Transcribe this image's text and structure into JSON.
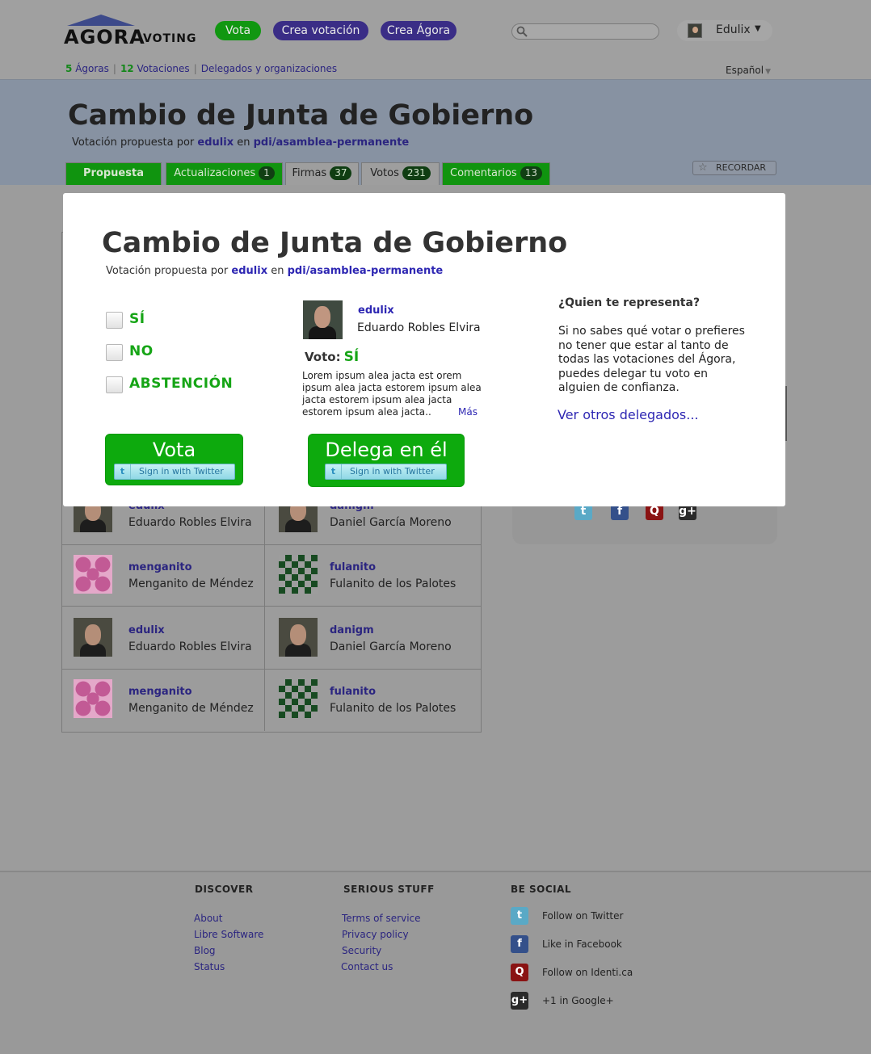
{
  "brand": {
    "logo_text": "AGORA",
    "logo_sub": "VOTING"
  },
  "header": {
    "vota_label": "Vota",
    "crea_votacion_label": "Crea votación",
    "crea_agora_label": "Crea Ágora",
    "search_placeholder": "",
    "user_name": "Edulix",
    "user_caret": "▼"
  },
  "subnav": {
    "agoras_count": "5",
    "agoras_label": "Ágoras",
    "votaciones_count": "12",
    "votaciones_label": "Votaciones",
    "delegados_label": "Delegados y organizaciones",
    "separator": "|",
    "language": "Español",
    "language_caret": "▼"
  },
  "banner": {
    "title": "Cambio de Junta de Gobierno",
    "sub_prefix": "Votación propuesta por",
    "author": "edulix",
    "sub_en": "en",
    "agora": "pdi/asamblea-permanente",
    "recordar_label": "RECORDAR",
    "tabs": [
      {
        "label": "Propuesta",
        "count": ""
      },
      {
        "label": "Actualizaciones",
        "count": "1"
      },
      {
        "label": "Firmas",
        "count": "37"
      },
      {
        "label": "Votos",
        "count": "231"
      },
      {
        "label": "Comentarios",
        "count": "13"
      }
    ]
  },
  "voters": [
    {
      "left_user": "edulix",
      "left_name": "Eduardo Robles Elvira",
      "right_user": "danigm",
      "right_name": "Daniel García Moreno"
    },
    {
      "left_user": "menganito",
      "left_name": "Menganito de Méndez",
      "right_user": "fulanito",
      "right_name": "Fulanito de los Palotes"
    },
    {
      "left_user": "edulix",
      "left_name": "Eduardo Robles Elvira",
      "right_user": "danigm",
      "right_name": "Daniel García Moreno"
    },
    {
      "left_user": "menganito",
      "left_name": "Menganito de Méndez",
      "right_user": "fulanito",
      "right_name": "Fulanito de los Palotes"
    }
  ],
  "modal": {
    "title": "Cambio de Junta de Gobierno",
    "sub_prefix": "Votación propuesta por",
    "author": "edulix",
    "sub_en": "en",
    "agora": "pdi/asamblea-permanente",
    "options": [
      "SÍ",
      "NO",
      "ABSTENCIÓN"
    ],
    "vote_button": "Vota",
    "twitter_signin": "Sign in with Twitter",
    "delegate": {
      "username": "edulix",
      "full_name": "Eduardo Robles Elvira",
      "vote_label": "Voto:",
      "vote_value": "SÍ",
      "text": "Lorem ipsum alea jacta est orem ipsum alea jacta estorem ipsum alea jacta estorem ipsum alea jacta estorem ipsum alea jacta..",
      "more": "Más",
      "button": "Delega en él"
    },
    "representa": {
      "title": "¿Quien te representa?",
      "text": "Si no sabes qué votar o prefieres no tener que estar al tanto de todas las votaciones del Ágora, puedes delegar tu voto en alguien de confianza.",
      "link": "Ver otros delegados..."
    }
  },
  "footer": {
    "discover": {
      "title": "DISCOVER",
      "links": [
        "About",
        "Libre Software",
        "Blog",
        "Status"
      ]
    },
    "serious": {
      "title": "SERIOUS STUFF",
      "links": [
        "Terms of service",
        "Privacy policy",
        "Security",
        "Contact us"
      ]
    },
    "social": {
      "title": "BE SOCIAL",
      "items": [
        {
          "label": "Follow on Twitter",
          "icon": "twitter-icon"
        },
        {
          "label": "Like in Facebook",
          "icon": "facebook-icon"
        },
        {
          "label": "Follow on Identi.ca",
          "icon": "identica-icon"
        },
        {
          "label": "+1 in Google+",
          "icon": "googleplus-icon"
        }
      ]
    }
  },
  "colors": {
    "green": "#10940f",
    "purple": "#3a2d86",
    "link": "#2e27b3",
    "option_green": "#16a516"
  }
}
